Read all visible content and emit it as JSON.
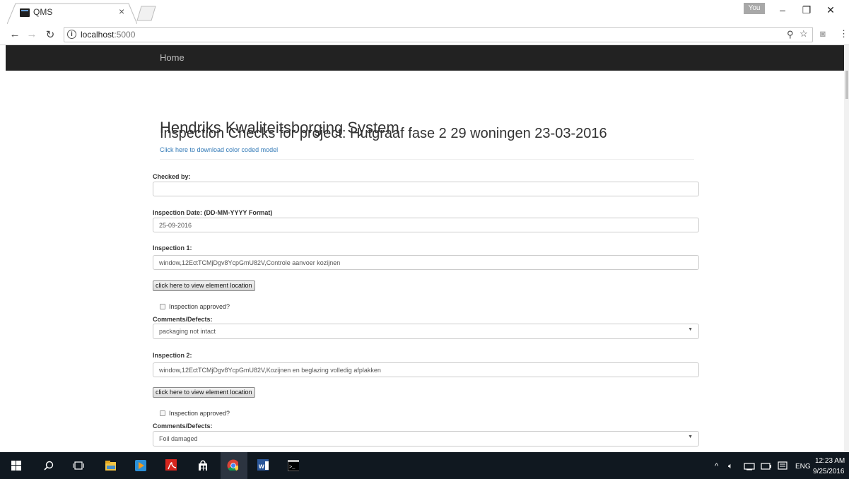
{
  "browser": {
    "tab_title": "QMS",
    "tab_close": "×",
    "profile_badge": "You",
    "window": {
      "minimize": "–",
      "restore": "❐",
      "close": "✕"
    },
    "url_host": "localhost",
    "url_port": ":5000"
  },
  "navbar": {
    "home_label": "Home"
  },
  "page": {
    "title": "Hendriks Kwaliteitsborging System",
    "subtitle": "Inspection Checks for project: Hutgraaf fase 2 29 woningen 23-03-2016",
    "download_link": "Click here to download color coded model"
  },
  "form": {
    "checked_by_label": "Checked by:",
    "checked_by_value": "",
    "date_label": "Inspection Date: (DD-MM-YYYY Format)",
    "date_value": "25-09-2016",
    "inspections": [
      {
        "label": "Inspection 1:",
        "value": "window,12EctTCMjDgv8YcpGmU82V,Controle aanvoer kozijnen",
        "location_button": "click here to view element location",
        "approved_label": "Inspection approved?",
        "comments_label": "Comments/Defects:",
        "comment_selected": "packaging not intact"
      },
      {
        "label": "Inspection 2:",
        "value": "window,12EctTCMjDgv8YcpGmU82V,Kozijnen en beglazing volledig afplakken",
        "location_button": "click here to view element location",
        "approved_label": "Inspection approved?",
        "comments_label": "Comments/Defects:",
        "comment_selected": "Foil damaged"
      }
    ]
  },
  "taskbar": {
    "language": "ENG",
    "time": "12:23 AM",
    "date": "9/25/2016"
  },
  "colors": {
    "navbar_bg": "#222222",
    "link": "#337ab7",
    "taskbar_bg": "#101820"
  }
}
